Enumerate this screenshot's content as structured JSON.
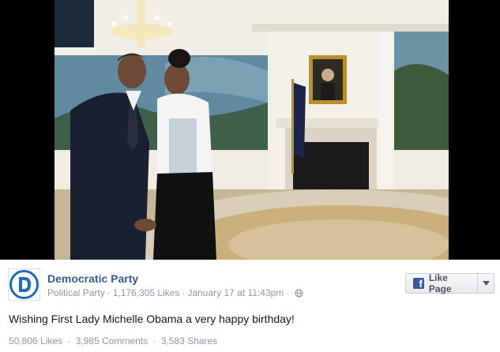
{
  "photo": {
    "description_icon": "photo-image"
  },
  "post": {
    "page_name": "Democratic Party",
    "category": "Political Party",
    "likes": "1,176,305 Likes",
    "timestamp": "January 17 at 11:43pm",
    "privacy_icon": "globe-icon",
    "message": "Wishing First Lady Michelle Obama a very happy birthday!",
    "stats": {
      "likes": "50,806 Likes",
      "comments": "3,985 Comments",
      "shares": "3,583 Shares"
    }
  },
  "like_button": {
    "label": "Like Page",
    "icon": "facebook-f-icon",
    "dropdown_icon": "caret-down-icon"
  },
  "colors": {
    "link_blue": "#3b5998",
    "meta_gray": "#9197a3",
    "text": "#141823"
  }
}
